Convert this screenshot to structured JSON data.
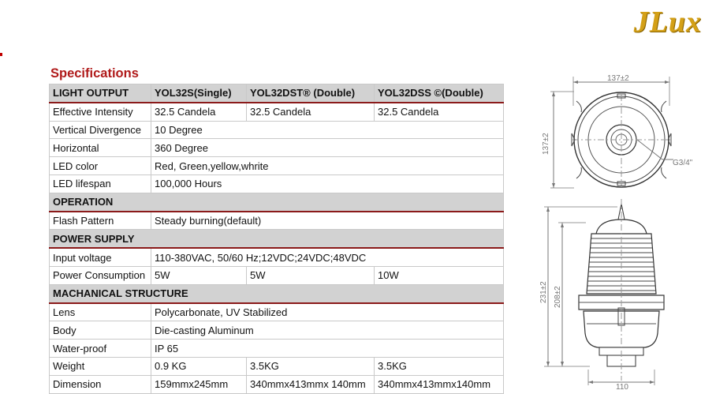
{
  "brand": {
    "logo_text": "JLux"
  },
  "page_title": "Specifications",
  "sections": [
    {
      "header": [
        "LIGHT OUTPUT",
        "YOL32S(Single)",
        "YOL32DST® (Double)",
        "YOL32DSS ©(Double)"
      ],
      "rows": [
        [
          "Effective Intensity",
          "32.5 Candela",
          "32.5 Candela",
          "32.5 Candela"
        ],
        [
          "Vertical Divergence",
          "10 Degree"
        ],
        [
          "Horizontal",
          "360 Degree"
        ],
        [
          "LED color",
          "Red, Green,yellow,whrite"
        ],
        [
          "LED lifespan",
          "100,000 Hours"
        ]
      ]
    },
    {
      "header": [
        "OPERATION"
      ],
      "rows": [
        [
          "Flash Pattern",
          "Steady burning(default)"
        ]
      ]
    },
    {
      "header": [
        "POWER SUPPLY"
      ],
      "rows": [
        [
          "Input voltage",
          "110-380VAC, 50/60 Hz;12VDC;24VDC;48VDC"
        ],
        [
          "Power Consumption",
          "5W",
          "5W",
          "10W"
        ]
      ]
    },
    {
      "header": [
        "MACHANICAL STRUCTURE"
      ],
      "rows": [
        [
          "Lens",
          "Polycarbonate, UV Stabilized"
        ],
        [
          "Body",
          "Die-casting Aluminum"
        ],
        [
          "Water-proof",
          "IP 65"
        ],
        [
          "Weight",
          "0.9 KG",
          "3.5KG",
          "3.5KG"
        ],
        [
          "Dimension",
          "159mmx245mm",
          "340mmx413mmx 140mm",
          "340mmx413mmx140mm"
        ]
      ]
    }
  ],
  "drawing": {
    "top_width": "137±2",
    "top_depth": "137±2",
    "thread": "G3/4\"",
    "height_overall": "231±2",
    "height_body": "208±2",
    "base_width": "110"
  }
}
